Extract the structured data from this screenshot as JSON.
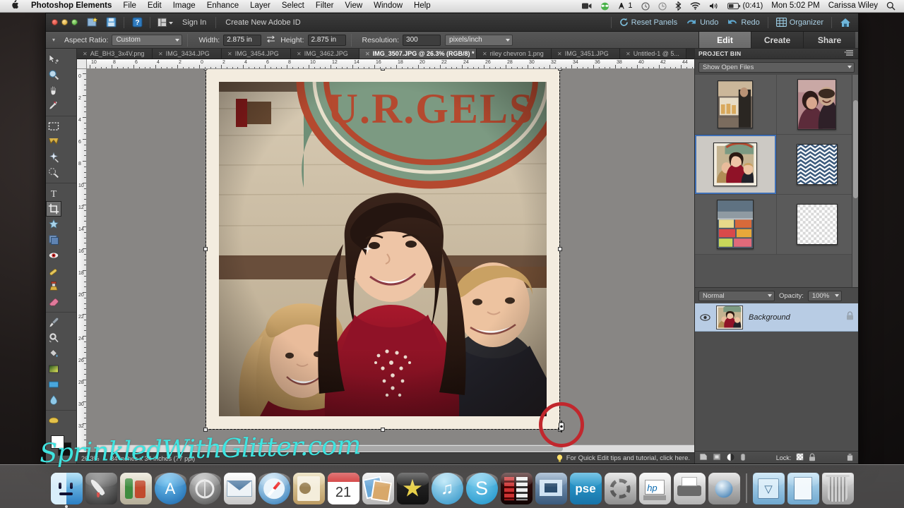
{
  "menubar": {
    "apple_icon": "apple-logo-icon",
    "app_name": "Photoshop Elements",
    "menus": [
      "File",
      "Edit",
      "Image",
      "Enhance",
      "Layer",
      "Select",
      "Filter",
      "View",
      "Window",
      "Help"
    ],
    "status_items": [
      {
        "icon": "screen-recording-icon",
        "label": ""
      },
      {
        "icon": "dropbox-icon",
        "label": ""
      },
      {
        "icon": "audio-meter-icon",
        "label": "1"
      },
      {
        "icon": "clock-alarm-icon",
        "label": ""
      },
      {
        "icon": "time-machine-icon",
        "label": ""
      },
      {
        "icon": "bluetooth-icon",
        "label": ""
      },
      {
        "icon": "wifi-icon",
        "label": ""
      },
      {
        "icon": "volume-icon",
        "label": ""
      },
      {
        "icon": "battery-icon",
        "label": "(0:41)"
      }
    ],
    "clock": "Mon 5:02 PM",
    "user": "Carissa Wiley",
    "search_icon": "spotlight-search-icon"
  },
  "appbar": {
    "new_icon": "new-file-icon",
    "save_icon": "save-icon",
    "help_icon": "help-icon",
    "layout_icon": "layout-icon",
    "sign_in": "Sign In",
    "create_id": "Create New Adobe ID",
    "reset_panels": "Reset Panels",
    "undo": "Undo",
    "redo": "Redo",
    "organizer": "Organizer",
    "home_icon": "home-icon"
  },
  "options": {
    "aspect_ratio_label": "Aspect Ratio:",
    "aspect_ratio_value": "Custom",
    "width_label": "Width:",
    "width_value": "2.875 in",
    "swap_icon": "swap-dimensions-icon",
    "height_label": "Height:",
    "height_value": "2.875 in",
    "resolution_label": "Resolution:",
    "resolution_value": "300",
    "resolution_units": "pixels/inch"
  },
  "mode_tabs": [
    {
      "label": "Edit",
      "active": true
    },
    {
      "label": "Create",
      "active": false
    },
    {
      "label": "Share",
      "active": false
    }
  ],
  "toolbox": [
    {
      "name": "move-tool",
      "selected": false
    },
    {
      "name": "zoom-tool",
      "selected": false
    },
    {
      "name": "hand-tool",
      "selected": false
    },
    {
      "name": "eyedropper-tool",
      "selected": false
    },
    {
      "name": "marquee-tool",
      "selected": false
    },
    {
      "name": "lasso-tool",
      "selected": false
    },
    {
      "name": "magic-wand-tool",
      "selected": false
    },
    {
      "name": "quick-selection-tool",
      "selected": false
    },
    {
      "name": "type-tool",
      "selected": false
    },
    {
      "name": "crop-tool",
      "selected": true
    },
    {
      "name": "cookie-cutter-tool",
      "selected": false
    },
    {
      "name": "straighten-tool",
      "selected": false
    },
    {
      "name": "red-eye-removal-tool",
      "selected": false
    },
    {
      "name": "healing-brush-tool",
      "selected": false
    },
    {
      "name": "clone-stamp-tool",
      "selected": false
    },
    {
      "name": "eraser-tool",
      "selected": false
    },
    {
      "name": "brush-tool",
      "selected": false
    },
    {
      "name": "smart-brush-tool",
      "selected": false
    },
    {
      "name": "paint-bucket-tool",
      "selected": false
    },
    {
      "name": "gradient-tool",
      "selected": false
    },
    {
      "name": "shape-tool",
      "selected": false
    },
    {
      "name": "blur-tool",
      "selected": false
    },
    {
      "name": "sponge-tool",
      "selected": false
    }
  ],
  "doc_tabs": [
    {
      "label": "AE_BH3_3x4V.png",
      "active": false
    },
    {
      "label": "IMG_3434.JPG",
      "active": false
    },
    {
      "label": "IMG_3454.JPG",
      "active": false
    },
    {
      "label": "IMG_3462.JPG",
      "active": false
    },
    {
      "label": "IMG_3507.JPG @ 26.3% (RGB/8) *",
      "active": true
    },
    {
      "label": "riley chevron 1.png",
      "active": false
    },
    {
      "label": "IMG_3451.JPG",
      "active": false
    },
    {
      "label": "Untitled-1 @ 5...",
      "active": false
    }
  ],
  "rulers": {
    "horizontal_labels": [
      "10",
      "8",
      "6",
      "4",
      "2",
      "0",
      "2",
      "4",
      "6",
      "8",
      "10",
      "12",
      "14",
      "16",
      "18",
      "20",
      "22",
      "24",
      "26",
      "28",
      "30",
      "32",
      "34",
      "36",
      "38",
      "40",
      "42",
      "44"
    ],
    "vertical_labels": [
      "0",
      "2",
      "4",
      "6",
      "8",
      "10",
      "12",
      "14",
      "16",
      "18",
      "20",
      "22",
      "24",
      "26",
      "28",
      "30",
      "32"
    ],
    "units": "inches"
  },
  "statusbar": {
    "zoom": "26.3%",
    "doc_size": "34 inches x 34 inches (77 ppi)",
    "tip_icon": "lightbulb-icon",
    "tip": "For Quick Edit tips and tutorial, click here."
  },
  "project_bin": {
    "title": "PROJECT BIN",
    "menu_icon": "panel-menu-icon",
    "filter_value": "Show Open Files",
    "thumbnails": [
      {
        "name": "bin-thumb-1",
        "kind": "photo-shop-interior",
        "selected": false
      },
      {
        "name": "bin-thumb-2",
        "kind": "photo-couple-selfie",
        "selected": false
      },
      {
        "name": "bin-thumb-3",
        "kind": "photo-family-three",
        "selected": true
      },
      {
        "name": "bin-thumb-4",
        "kind": "pattern-navy-chevron",
        "selected": false
      },
      {
        "name": "bin-thumb-5",
        "kind": "photo-food-display",
        "selected": false
      },
      {
        "name": "bin-thumb-6",
        "kind": "transparent-canvas",
        "selected": false
      }
    ]
  },
  "layers_panel": {
    "blend_mode": "Normal",
    "opacity_label": "Opacity:",
    "opacity_value": "100%",
    "layers": [
      {
        "name": "Background",
        "visible": true,
        "locked": true,
        "selected": true
      }
    ],
    "lock_label": "Lock:",
    "footer_icons": [
      "new-layer-icon",
      "new-fill-layer-icon",
      "adjustment-layer-icon",
      "layer-mask-icon",
      "lock-transparency-icon",
      "lock-all-icon",
      "delete-layer-icon"
    ]
  },
  "canvas": {
    "document_name": "IMG_3507.JPG",
    "annotation": {
      "name": "red-circle-annotation",
      "color": "#c1272d"
    },
    "sign_text": "U.R.GELS"
  },
  "watermark": {
    "text": "SprinkledWithGlitter.com",
    "color": "#3fe4e0"
  },
  "dock": {
    "items": [
      {
        "name": "dock-finder",
        "label": "Finder"
      },
      {
        "name": "dock-launchpad",
        "label": "Launchpad"
      },
      {
        "name": "dock-app-store-green",
        "label": "Installer"
      },
      {
        "name": "dock-app-store",
        "label": "App Store"
      },
      {
        "name": "dock-system-preferences",
        "label": "System Preferences"
      },
      {
        "name": "dock-mail",
        "label": "Mail"
      },
      {
        "name": "dock-safari",
        "label": "Safari"
      },
      {
        "name": "dock-contacts",
        "label": "Contacts"
      },
      {
        "name": "dock-calendar",
        "label": "Calendar"
      },
      {
        "name": "dock-iphoto",
        "label": "iPhoto"
      },
      {
        "name": "dock-imovie",
        "label": "iMovie"
      },
      {
        "name": "dock-itunes",
        "label": "iTunes"
      },
      {
        "name": "dock-skype",
        "label": "Skype"
      },
      {
        "name": "dock-video-editor",
        "label": "Video Editor"
      },
      {
        "name": "dock-dvd-player",
        "label": "DVD Player"
      },
      {
        "name": "dock-photoshop-elements",
        "label": "pse"
      },
      {
        "name": "dock-utility",
        "label": "Utility"
      },
      {
        "name": "dock-hp-utility",
        "label": "HP Utility"
      },
      {
        "name": "dock-hp-printer",
        "label": "HP Printer"
      },
      {
        "name": "dock-preview",
        "label": "Preview"
      },
      {
        "name": "dock-downloads-folder",
        "label": "Downloads"
      },
      {
        "name": "dock-documents-folder",
        "label": "Documents"
      },
      {
        "name": "dock-trash",
        "label": "Trash"
      }
    ]
  }
}
